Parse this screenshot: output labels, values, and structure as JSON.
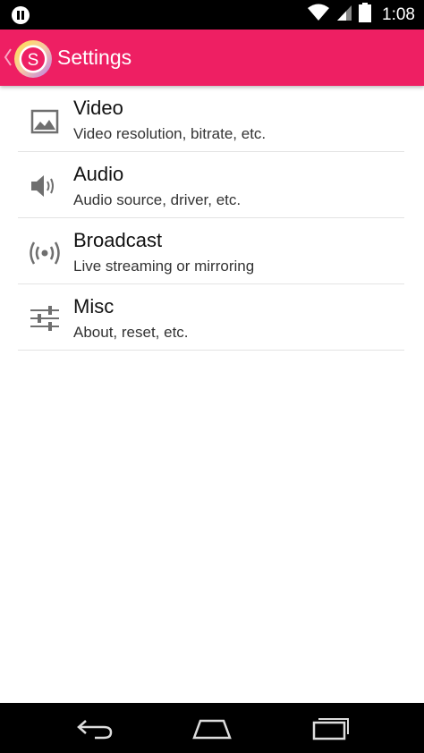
{
  "status_bar": {
    "time": "1:08",
    "icons": [
      "pause-icon",
      "wifi-icon",
      "signal-icon",
      "battery-icon"
    ]
  },
  "app_bar": {
    "title": "Settings",
    "logo_letter": "S",
    "back_icon": "chevron-left-icon"
  },
  "settings": {
    "items": [
      {
        "title": "Video",
        "subtitle": "Video resolution, bitrate, etc.",
        "icon": "image-icon"
      },
      {
        "title": "Audio",
        "subtitle": "Audio source, driver, etc.",
        "icon": "speaker-icon"
      },
      {
        "title": "Broadcast",
        "subtitle": "Live streaming or mirroring",
        "icon": "broadcast-icon"
      },
      {
        "title": "Misc",
        "subtitle": "About, reset, etc.",
        "icon": "sliders-icon"
      }
    ]
  },
  "nav_bar": {
    "buttons": [
      "back-icon",
      "home-icon",
      "recent-apps-icon"
    ]
  },
  "colors": {
    "accent": "#ee1f63",
    "status_bar": "#000000",
    "icon_gray": "#6f6f6f"
  }
}
